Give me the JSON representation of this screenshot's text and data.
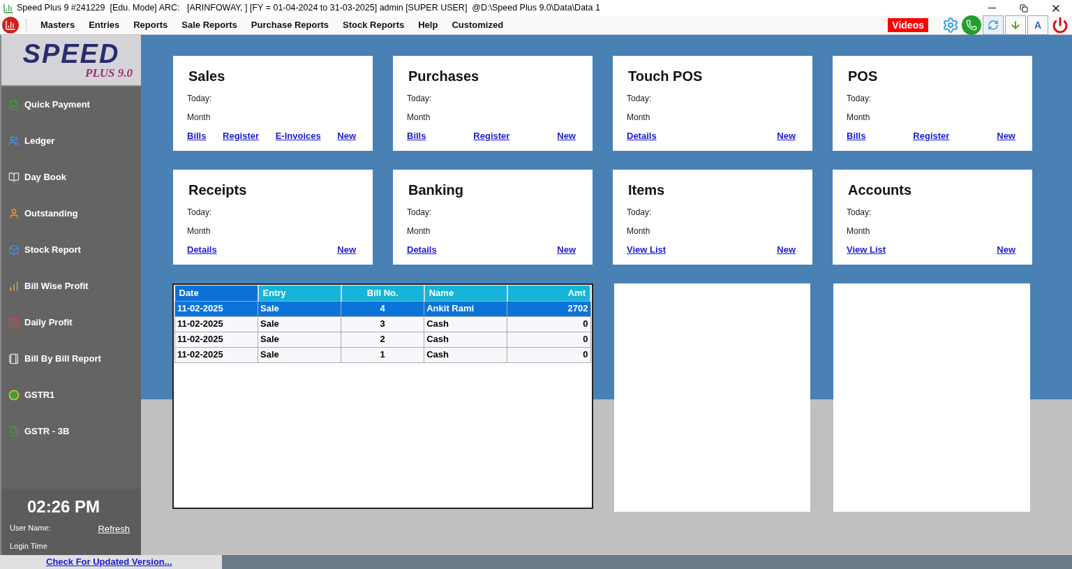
{
  "window": {
    "title": "Speed Plus 9 #241229  [Edu. Mode] ARC:   [ARINFOWAY, ] [FY = 01-04-2024 to 31-03-2025] admin [SUPER USER]  @D:\\Speed Plus 9.0\\Data\\Data 1"
  },
  "menu": [
    "Masters",
    "Entries",
    "Reports",
    "Sale Reports",
    "Purchase Reports",
    "Stock Reports",
    "Help",
    "Customized"
  ],
  "toolbar": {
    "videos": "Videos",
    "font_button": "A"
  },
  "logo": {
    "word": "SPEED",
    "sub": "PLUS 9.0"
  },
  "sidebar": {
    "items": [
      {
        "label": "Quick Payment",
        "kind": "check"
      },
      {
        "label": "Ledger",
        "kind": "users"
      },
      {
        "label": "Day Book",
        "kind": "book"
      },
      {
        "label": "Outstanding",
        "kind": "person"
      },
      {
        "label": "Stock Report",
        "kind": "box"
      },
      {
        "label": "Bill Wise Profit",
        "kind": "chart"
      },
      {
        "label": "Daily Profit",
        "kind": "calendar"
      },
      {
        "label": "Bill By Bill Report",
        "kind": "notebook"
      },
      {
        "label": "GSTR1",
        "kind": "circles"
      },
      {
        "label": "GSTR - 3B",
        "kind": "check"
      }
    ],
    "time": "02:26 PM",
    "user_name_label": "User Name:",
    "refresh": "Refresh",
    "login_time_label": "Login Time"
  },
  "cards": [
    {
      "title": "Sales",
      "today": "Today:",
      "month": "Month",
      "links": [
        "Bills",
        "Register",
        "E-Invoices",
        "New"
      ]
    },
    {
      "title": "Purchases",
      "today": "Today:",
      "month": "Month",
      "links": [
        "Bills",
        "Register",
        "New"
      ]
    },
    {
      "title": "Touch POS",
      "today": "Today:",
      "month": "Month",
      "links": [
        "Details",
        "New"
      ]
    },
    {
      "title": "POS",
      "today": "Today:",
      "month": "Month",
      "links": [
        "Bills",
        "Register",
        "New"
      ]
    },
    {
      "title": "Receipts",
      "today": "Today:",
      "month": "Month",
      "links": [
        "Details",
        "New"
      ]
    },
    {
      "title": "Banking",
      "today": "Today:",
      "month": "Month",
      "links": [
        "Details",
        "New"
      ]
    },
    {
      "title": "Items",
      "today": "Today:",
      "month": "Month",
      "links": [
        "View List",
        "New"
      ]
    },
    {
      "title": "Accounts",
      "today": "Today:",
      "month": "Month",
      "links": [
        "View List",
        "New"
      ]
    }
  ],
  "table": {
    "columns": [
      {
        "label": "Date",
        "kind": "text",
        "selected": true
      },
      {
        "label": "Entry",
        "kind": "text",
        "selected": false
      },
      {
        "label": "Bill No.",
        "kind": "number",
        "selected": false
      },
      {
        "label": "Name",
        "kind": "text",
        "selected": false
      },
      {
        "label": "Amt",
        "kind": "amount",
        "selected": false
      }
    ],
    "rows": [
      {
        "cells": [
          "11-02-2025",
          "Sale",
          "4",
          "Ankit Rami",
          "2702"
        ],
        "selected": true
      },
      {
        "cells": [
          "11-02-2025",
          "Sale",
          "3",
          "Cash",
          "0"
        ],
        "selected": false
      },
      {
        "cells": [
          "11-02-2025",
          "Sale",
          "2",
          "Cash",
          "0"
        ],
        "selected": false
      },
      {
        "cells": [
          "11-02-2025",
          "Sale",
          "1",
          "Cash",
          "0"
        ],
        "selected": false
      }
    ]
  },
  "status_bar": {
    "link": "Check For Updated Version..."
  }
}
